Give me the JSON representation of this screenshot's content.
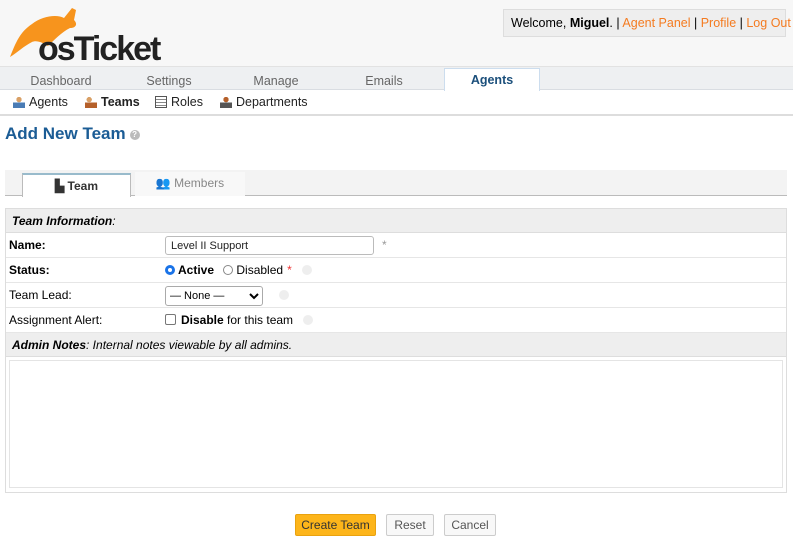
{
  "header": {
    "logo_text": "osTicket",
    "welcome": "Welcome, ",
    "user": "Miguel",
    "sep": ". | ",
    "agent_panel": "Agent Panel",
    "profile": "Profile",
    "logout": "Log Out",
    "pipe": " | "
  },
  "nav": [
    {
      "label": "Dashboard"
    },
    {
      "label": "Settings"
    },
    {
      "label": "Manage"
    },
    {
      "label": "Emails"
    },
    {
      "label": "Agents"
    }
  ],
  "subnav": [
    {
      "label": "Agents"
    },
    {
      "label": "Teams"
    },
    {
      "label": "Roles"
    },
    {
      "label": "Departments"
    }
  ],
  "page": {
    "title": "Add New Team"
  },
  "tabs": {
    "team": "Team",
    "members": "Members"
  },
  "form": {
    "section_title": "Team Information",
    "section_suffix": ":",
    "name_label": "Name:",
    "name_value": "Level II Support",
    "req": "*",
    "status_label": "Status:",
    "active": "Active",
    "disabled": "Disabled",
    "lead_label": "Team Lead:",
    "lead_value": "— None —",
    "alert_label": "Assignment Alert:",
    "alert_bold": "Disable",
    "alert_rest": " for this team",
    "notes_title": "Admin Notes",
    "notes_desc": ": Internal notes viewable by all admins."
  },
  "buttons": {
    "create": "Create Team",
    "reset": "Reset",
    "cancel": "Cancel"
  },
  "colors": {
    "accent": "#f47b20",
    "title": "#1b5c95",
    "create": "#fdb51a"
  }
}
